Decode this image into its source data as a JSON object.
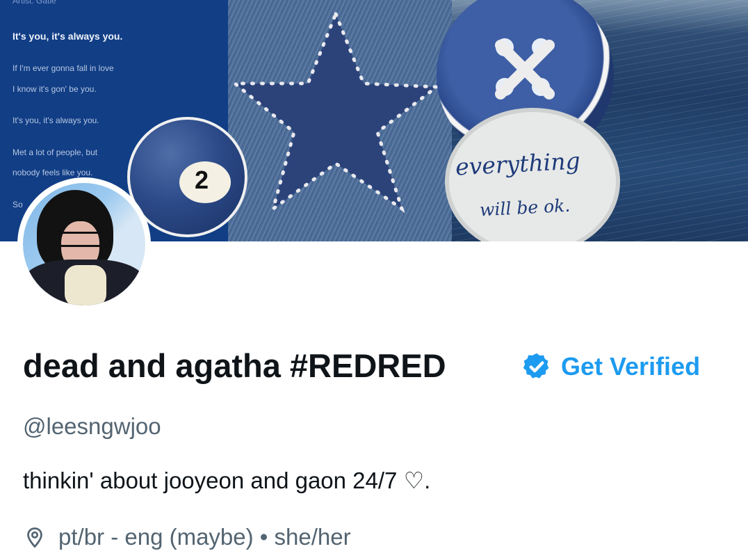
{
  "banner": {
    "lyrics": {
      "artist": "Artist: Gatie",
      "lines": [
        "It's you, it's always you.",
        "If I'm ever gonna fall in love",
        "I know it's gon' be you.",
        "It's you, it's always you.",
        "Met a lot of people, but",
        "nobody feels like you.",
        "So"
      ]
    },
    "billiard_number": "2",
    "button_text_line1": "everything",
    "button_text_line2": "will be ok."
  },
  "profile": {
    "display_name": "dead and agatha #REDRED",
    "get_verified_label": "Get Verified",
    "handle": "@leesngwjoo",
    "bio": "thinkin' about jooyeon and gaon 24/7 ♡.",
    "location": "pt/br - eng (maybe) • she/her"
  },
  "colors": {
    "accent": "#1d9bf0",
    "text_primary": "#0f1419",
    "text_secondary": "#536471"
  },
  "icons": {
    "verified": "verified-badge-icon",
    "location": "location-pin-icon"
  }
}
